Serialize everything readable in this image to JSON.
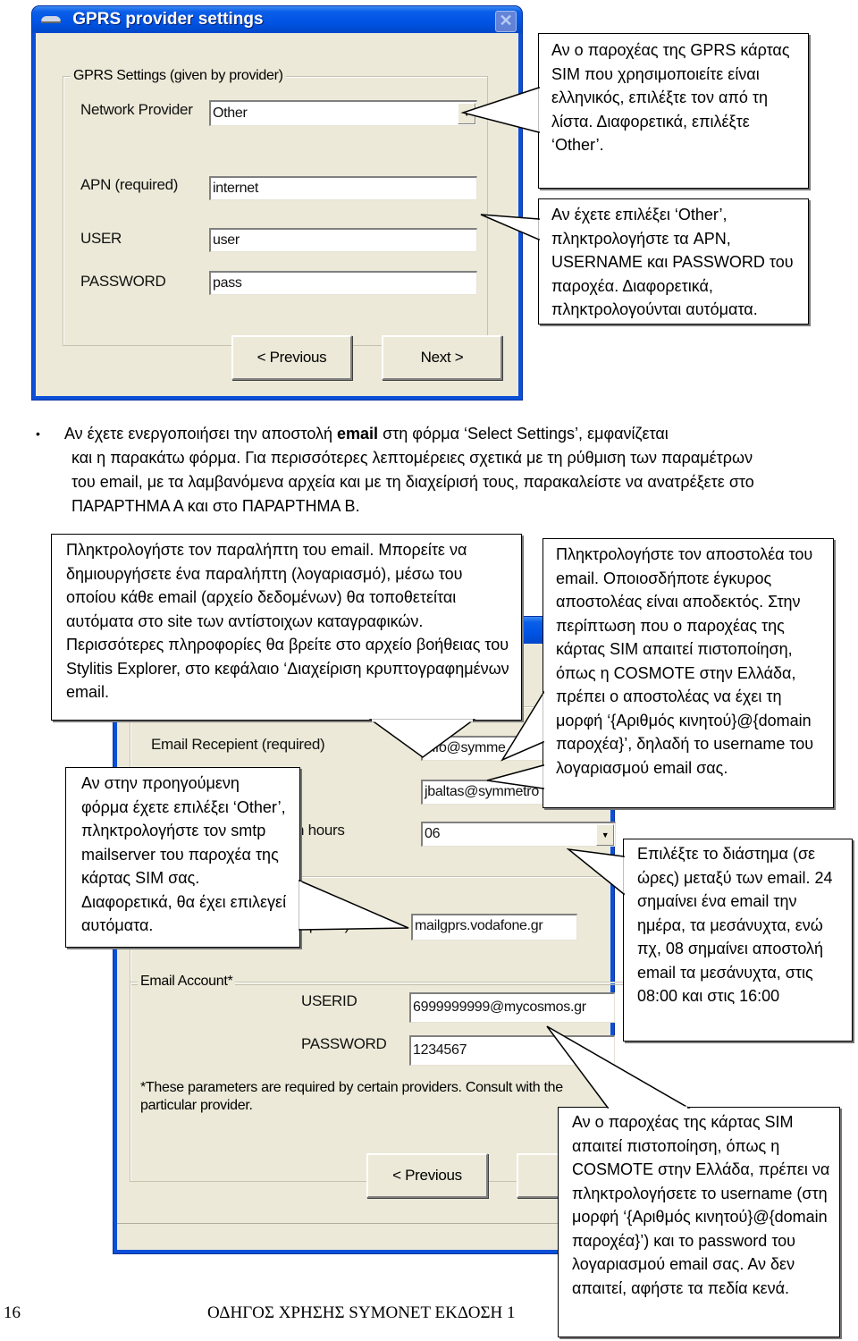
{
  "dialog1": {
    "title": "GPRS provider settings",
    "group_label": "GPRS Settings (given by provider)",
    "fields": [
      {
        "label": "Network Provider",
        "value": "Other",
        "type": "dropdown"
      },
      {
        "label": "APN (required)",
        "value": "internet",
        "type": "text"
      },
      {
        "label": "USER",
        "value": "user",
        "type": "text"
      },
      {
        "label": "PASSWORD",
        "value": "pass",
        "type": "text"
      }
    ],
    "buttons": {
      "previous": "< Previous",
      "next": "Next >"
    },
    "close_icon": "close-icon"
  },
  "callouts_top": [
    {
      "text": "Αν ο παροχέας της GPRS κάρτας SIM που χρησιμοποιείτε είναι ελληνικός, επιλέξτε τον από τη λίστα. Διαφορετικά, επιλέξτε ‘Other’."
    },
    {
      "text": "Αν έχετε επιλέξει ‘Other’, πληκτρολογήστε τα APN, USERNAME και PASSWORD του παροχέα. Διαφορετικά, πληκτρολογούνται αυτόματα."
    }
  ],
  "paragraph": {
    "bullet": "•",
    "before_bold": "Αν έχετε ενεργοποιήσει την αποστολή ",
    "bold": "email",
    "after_bold": " στη φόρμα ‘Select Settings’, εμφανίζεται",
    "rest": "και η παρακάτω φόρμα. Για περισσότερες λεπτομέρειες σχετικά με τη ρύθμιση των παραμέτρων του email, με τα λαμβανόμενα αρχεία και με τη διαχείρισή τους, παρακαλείστε να ανατρέξετε στο ΠΑΡΑΡΤΗΜΑ Α και στο ΠΑΡΑΡΤΗΜΑ Β."
  },
  "dialog2": {
    "fields": [
      {
        "label": "Email Recepient (required)",
        "value": "info@symme"
      },
      {
        "label": "",
        "value": "jbaltas@symmetro"
      },
      {
        "label": "h hours",
        "value": "06",
        "type": "dropdown"
      },
      {
        "label": "equired)",
        "value": "mailgprs.vodafone.gr"
      }
    ],
    "account_group_label": "Email Account*",
    "account_fields": [
      {
        "label": "USERID",
        "value": "6999999999@mycosmos.gr"
      },
      {
        "label": "PASSWORD",
        "value": "1234567"
      }
    ],
    "footnote": "*These parameters are required by certain providers. Consult with the particular provider.",
    "buttons": {
      "previous": "< Previous"
    }
  },
  "callouts_bottom": [
    {
      "name": "recipient",
      "text": "Πληκτρολογήστε τον παραλήπτη του email. Μπορείτε να δημιουργήσετε ένα παραλήπτη (λογαριασμό), μέσω του οποίου κάθε email (αρχείο δεδομένων) θα τοποθετείται αυτόματα στο site των αντίστοιχων καταγραφικών. Περισσότερες πληροφορίες θα βρείτε στο αρχείο βοήθειας του  Stylitis Explorer, στο κεφάλαιο ‘Διαχείριση κρυπτογραφημένων email."
    },
    {
      "name": "sender",
      "text": "Πληκτρολογήστε τον αποστολέα του email. Οποιοσδήποτε έγκυρος αποστολέας είναι αποδεκτός. Στην περίπτωση που ο παροχέας της κάρτας SIM απαιτεί πιστοποίηση, όπως η COSMOTE στην Ελλάδα, πρέπει ο αποστολέας να έχει τη μορφή ‘{Αριθμός κινητού}@{domain παροχέα}’, δηλαδή το username του λογαριασμού email σας."
    },
    {
      "name": "smtp",
      "text": "Αν στην προηγούμενη φόρμα έχετε επιλέξει ‘Other’, πληκτρολογήστε τον smtp mailserver του παροχέα της κάρτας SIM σας. Διαφορετικά, θα έχει επιλεγεί αυτόματα."
    },
    {
      "name": "interval",
      "text": "Επιλέξτε το διάστημα (σε ώρες) μεταξύ των email. 24 σημαίνει ένα email την ημέρα, τα μεσάνυχτα, ενώ πχ, 08 σημαίνει αποστολή email τα μεσάνυχτα, στις 08:00 και στις 16:00"
    },
    {
      "name": "account",
      "text": "Αν ο παροχέας της κάρτας SIM απαιτεί πιστοποίηση, όπως η COSMOTE στην Ελλάδα, πρέπει να πληκτρολογήσετε το username (στη μορφή ‘{Αριθμός κινητού}@{domain παροχέα}’) και το password του λογαριασμού email σας. Αν δεν απαιτεί, αφήστε τα πεδία κενά."
    }
  ],
  "footer": {
    "page_number": "16",
    "title": "ΟΔΗΓΟΣ ΧΡΗΣΗΣ SYMONET ΕΚΔΟΣΗ 1"
  }
}
